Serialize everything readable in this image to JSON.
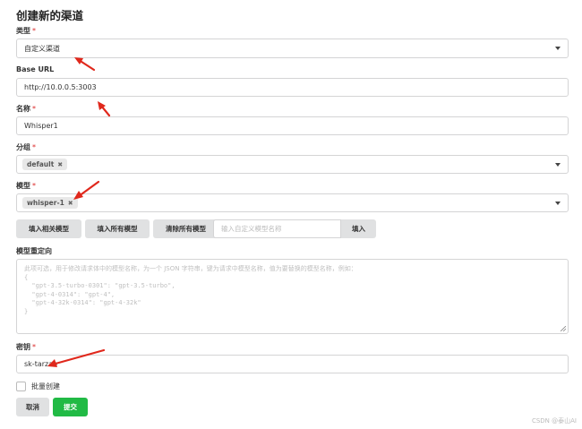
{
  "form": {
    "title": "创建新的渠道",
    "type": {
      "label": "类型",
      "value": "自定义渠道"
    },
    "base_url": {
      "label": "Base URL",
      "value": "http://10.0.0.5:3003"
    },
    "name": {
      "label": "名称",
      "value": "Whisper1"
    },
    "group": {
      "label": "分组",
      "tag": "default"
    },
    "model": {
      "label": "模型",
      "tag": "whisper-1"
    },
    "model_buttons": {
      "fill_related": "填入相关模型",
      "fill_all": "填入所有模型",
      "clear_all": "清除所有模型",
      "custom_placeholder": "输入自定义模型名称",
      "fill": "填入"
    },
    "mapping": {
      "label": "模型重定向",
      "placeholder_lines": [
        "此项可选，用于修改请求体中的模型名称，为一个 JSON 字符串，键为请求中模型名称，值为要替换的模型名称，例如：",
        "{",
        "  \"gpt-3.5-turbo-0301\": \"gpt-3.5-turbo\",",
        "  \"gpt-4-0314\": \"gpt-4\",",
        "  \"gpt-4-32k-0314\": \"gpt-4-32k\"",
        "}"
      ]
    },
    "key": {
      "label": "密钥",
      "value": "sk-tarzan"
    },
    "batch_label": "批量创建",
    "cancel": "取消",
    "submit": "提交",
    "required_mark": "*"
  },
  "watermark": "CSDN @泰山AI",
  "colors": {
    "submit_green": "#21ba45",
    "arrow_red": "#e0281c",
    "required_red": "#db2828"
  },
  "icons": [
    "dropdown-caret-icon",
    "remove-tag-icon",
    "resize-handle-icon",
    "annotation-arrow-icon"
  ]
}
